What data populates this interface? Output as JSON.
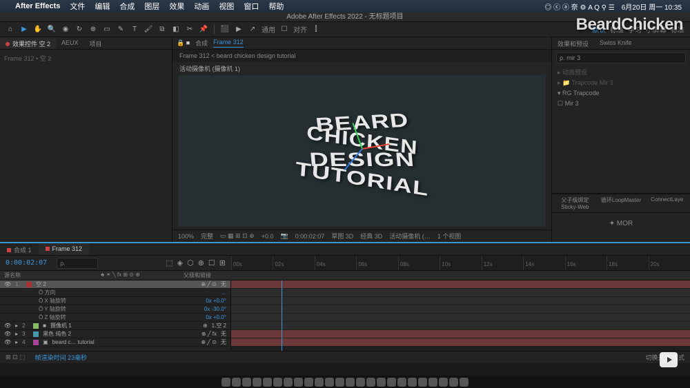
{
  "menubar": {
    "apple_glyph": "",
    "app_name": "After Effects",
    "items": [
      "文件",
      "编辑",
      "合成",
      "图层",
      "效果",
      "动画",
      "视图",
      "窗口",
      "帮助"
    ],
    "status_icons": "◎ ⓒ ⓐ 奈 ⚙ A Q ⚲ ☰",
    "date": "6月20日 周一 10:35"
  },
  "window_title": "Adobe After Effects 2022 - 无标题项目",
  "toolbar": {
    "align_label": "对齐",
    "default_workspace": "默认",
    "workspaces": [
      "标准",
      "学习",
      "小屏幕",
      "标准"
    ],
    "snap_label": "通用"
  },
  "left_panel": {
    "tabs": [
      "效果控件 空 2",
      "AEUX",
      "项目"
    ],
    "subtitle": "Frame 312 • 空 2"
  },
  "viewer": {
    "tab_composition": "合成",
    "tab_active": "Frame 312",
    "breadcrumb": "Frame 312  <  beard chicken design tutorial",
    "camera_label": "活动摄像机 (摄像机 1)",
    "text_lines": [
      "BEARD",
      "CHICKEN",
      "DESIGN",
      "TUTORIAL"
    ],
    "footer": {
      "zoom": "100%",
      "quality": "完整",
      "fx": "+0.0",
      "timecode": "0:00:02:07",
      "view_mode": "草图 3D",
      "renderer": "经典 3D",
      "camera": "活动摄像机 (…",
      "views": "1 个视图"
    }
  },
  "right_panel": {
    "tabs": [
      "效果和预设",
      "Swiss Knife"
    ],
    "search_placeholder": "ρ. mir 3",
    "tree": [
      "▸ 动画预设",
      "▸ 📁 Trapcode Mir 3",
      "▾ RG Trapcode",
      "   ☐ Mir 3"
    ],
    "bottom_tabs": [
      "父子级绑定Sticky-Web",
      "循环LoopMaster",
      "ConnectLaye"
    ],
    "bottom_label": "MOR"
  },
  "timeline": {
    "tabs": [
      "合成 1",
      "Frame 312"
    ],
    "timecode": "0:00:02:07",
    "ruler_ticks": [
      "00s",
      "02s",
      "04s",
      "06s",
      "08s",
      "10s",
      "12s",
      "14s",
      "16s",
      "18s",
      "20s"
    ],
    "col_headers": {
      "source": "源名称",
      "parent": "父级和链接"
    },
    "layers": [
      {
        "num": "1",
        "name": "空 2",
        "parent": "无",
        "sel": true,
        "swatch": "sw-r"
      },
      {
        "prop_row": true,
        "name": "Ŏ 方向",
        "val": "..."
      },
      {
        "prop_row": true,
        "name": "Ŏ X 轴旋转",
        "val": "0x +0.0°"
      },
      {
        "prop_row": true,
        "name": "Ŏ Y 轴旋转",
        "val": "0x -30.0°"
      },
      {
        "prop_row": true,
        "name": "Ŏ Z 轴旋转",
        "val": "0x +0.0°"
      },
      {
        "num": "2",
        "name": "摄像机 1",
        "parent": "1.空 2",
        "swatch": "sw-b"
      },
      {
        "num": "3",
        "name": "黑色 纯色 2",
        "parent": "无",
        "swatch": "sw-c"
      },
      {
        "num": "4",
        "name": "beard c… tutorial",
        "parent": "无",
        "swatch": "sw-p"
      }
    ],
    "footer": {
      "frame_blending": "帧渲染时间 23毫秒",
      "toggle": "切换开关/模式"
    }
  },
  "watermark": "BeardChicken"
}
